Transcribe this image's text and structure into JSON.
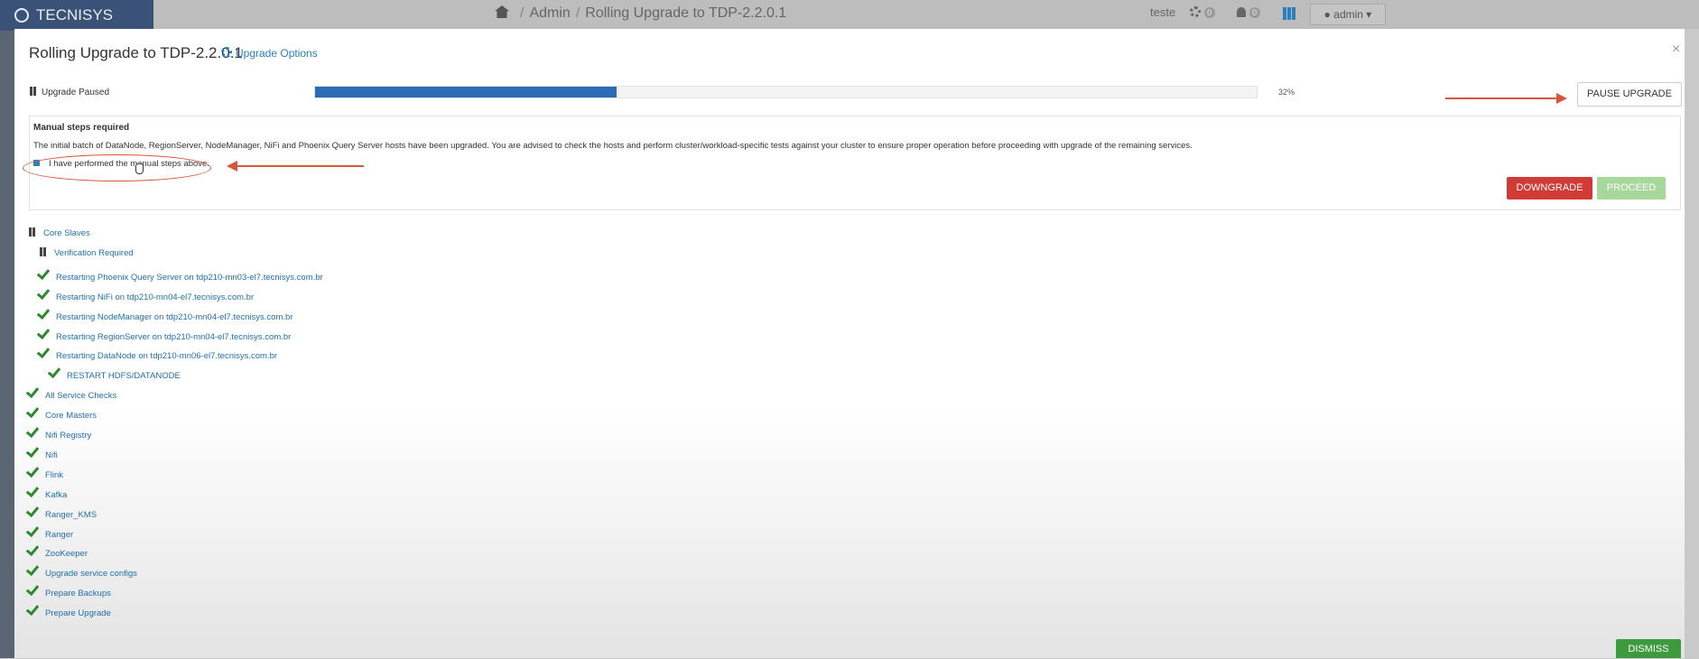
{
  "app": {
    "brand": "TECNISYS",
    "breadcrumb": [
      "Admin",
      "Rolling Upgrade to TDP-2.2.0.1"
    ],
    "user_label": "teste",
    "ops_count": "0",
    "alerts_count": "0",
    "admin_menu": "admin"
  },
  "modal": {
    "title": "Rolling Upgrade to TDP-2.2.0.1",
    "upgrade_options": "Upgrade Options",
    "status": "Upgrade Paused",
    "progress_percent": 32,
    "progress_label": "32%",
    "pause_button": "PAUSE UPGRADE",
    "manual": {
      "title": "Manual steps required",
      "text": "The initial batch of DataNode, RegionServer, NodeManager, NiFi and Phoenix Query Server hosts have been upgraded. You are advised to check the hosts and perform cluster/workload-specific tests against your cluster to ensure proper operation before proceeding with upgrade of the remaining services.",
      "confirm": "I have performed the manual steps above.",
      "confirm_checked": false
    },
    "downgrade_button": "DOWNGRADE",
    "proceed_button": "PROCEED",
    "dismiss_button": "DISMISS",
    "steps": [
      {
        "label": "Core Slaves",
        "icon": "pause-icon",
        "level": 0
      },
      {
        "label": "Verification Required",
        "icon": "pause-icon",
        "level": 1
      },
      {
        "label": "Restarting Phoenix Query Server on tdp210-mn03-el7.tecnisys.com.br",
        "icon": "check-icon",
        "level": 1
      },
      {
        "label": "Restarting NiFi on tdp210-mn04-el7.tecnisys.com.br",
        "icon": "check-icon",
        "level": 1
      },
      {
        "label": "Restarting NodeManager on tdp210-mn04-el7.tecnisys.com.br",
        "icon": "check-icon",
        "level": 1
      },
      {
        "label": "Restarting RegionServer on tdp210-mn04-el7.tecnisys.com.br",
        "icon": "check-icon",
        "level": 1
      },
      {
        "label": "Restarting DataNode on tdp210-mn06-el7.tecnisys.com.br",
        "icon": "check-icon",
        "level": 1
      },
      {
        "label": "RESTART HDFS/DATANODE",
        "icon": "check-icon",
        "level": 2
      },
      {
        "label": "All Service Checks",
        "icon": "check-icon",
        "level": 0
      },
      {
        "label": "Core Masters",
        "icon": "check-icon",
        "level": 0
      },
      {
        "label": "Nifi Registry",
        "icon": "check-icon",
        "level": 0
      },
      {
        "label": "Nifi",
        "icon": "check-icon",
        "level": 0
      },
      {
        "label": "Flink",
        "icon": "check-icon",
        "level": 0
      },
      {
        "label": "Kafka",
        "icon": "check-icon",
        "level": 0
      },
      {
        "label": "Ranger_KMS",
        "icon": "check-icon",
        "level": 0
      },
      {
        "label": "Ranger",
        "icon": "check-icon",
        "level": 0
      },
      {
        "label": "ZooKeeper",
        "icon": "check-icon",
        "level": 0
      },
      {
        "label": "Upgrade service configs",
        "icon": "check-icon",
        "level": 0
      },
      {
        "label": "Prepare Backups",
        "icon": "check-icon",
        "level": 0
      },
      {
        "label": "Prepare Upgrade",
        "icon": "check-icon",
        "level": 0
      }
    ]
  },
  "colors": {
    "accent": "#2a7fbd",
    "progress": "#2c6bb6",
    "danger": "#d03b35",
    "success": "#2c8a2c",
    "annotation": "#d9553c"
  }
}
